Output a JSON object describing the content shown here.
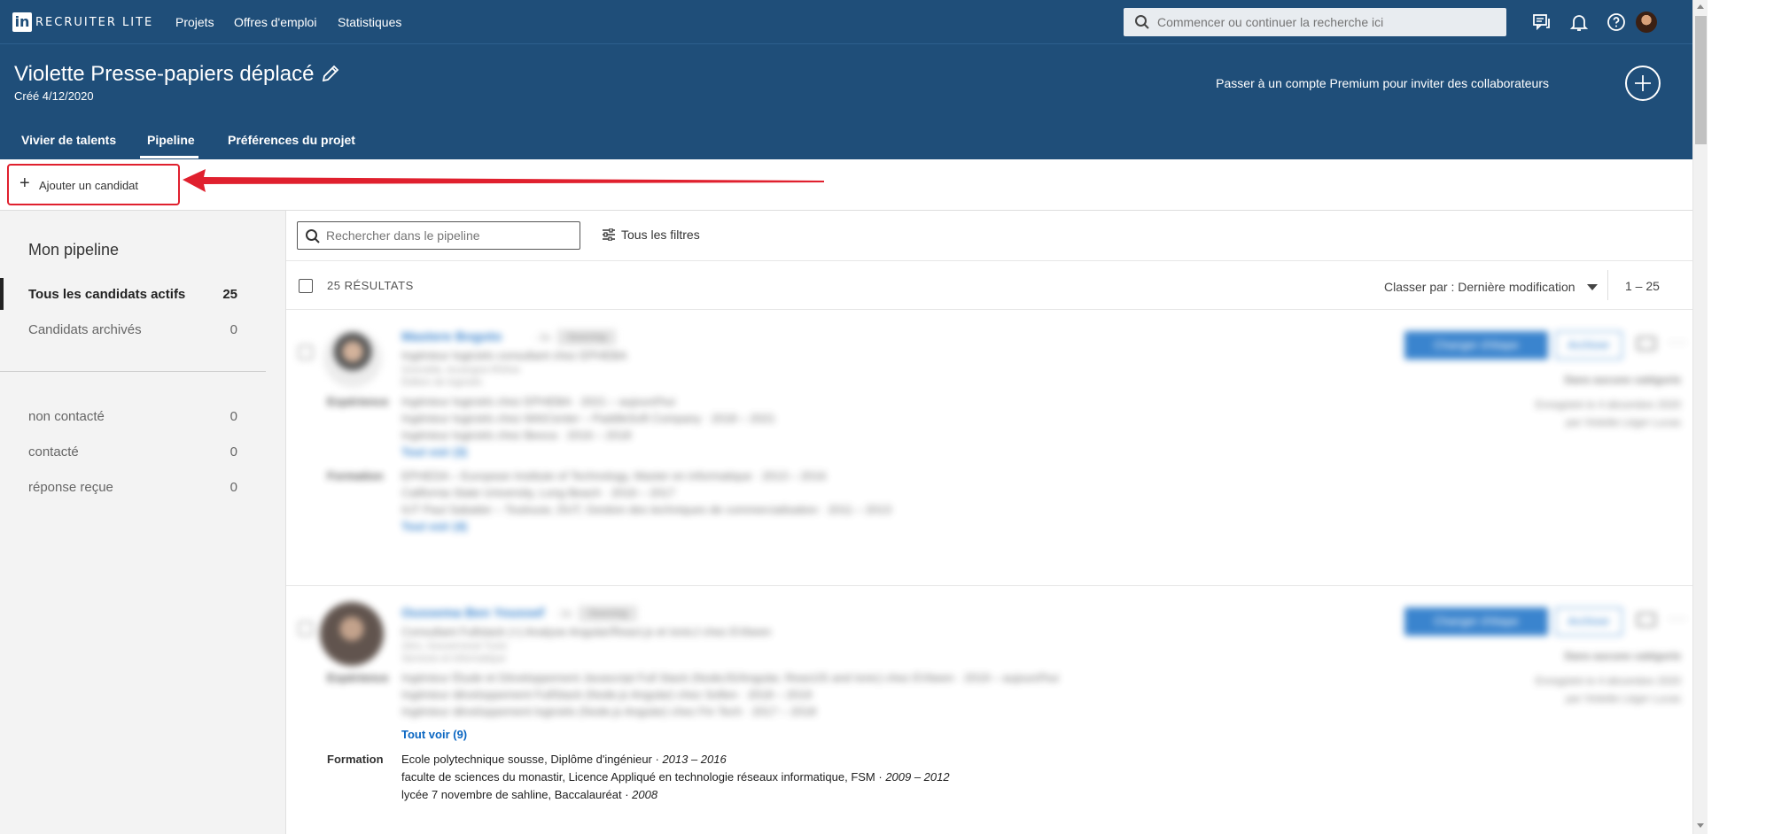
{
  "app": {
    "logo_mark": "in",
    "logo_text": "RECRUITER LITE"
  },
  "nav": {
    "projects": "Projets",
    "jobs": "Offres d'emploi",
    "stats": "Statistiques"
  },
  "search": {
    "placeholder": "Commencer ou continuer la recherche ici"
  },
  "project": {
    "title": "Violette Presse-papiers déplacé",
    "created": "Créé 4/12/2020",
    "premium_text": "Passer à un compte Premium pour inviter des collaborateurs"
  },
  "tabs": [
    {
      "label": "Vivier de talents"
    },
    {
      "label": "Pipeline",
      "active": true
    },
    {
      "label": "Préférences du projet"
    }
  ],
  "toolbar": {
    "add_candidate": "Ajouter un candidat",
    "plus": "+"
  },
  "annotation": {
    "arrow_color": "#e0202e",
    "highlight_color": "#e0202e"
  },
  "sidebar": {
    "title": "Mon pipeline",
    "items": [
      {
        "label": "Tous les candidats actifs",
        "count": "25",
        "active": true
      },
      {
        "label": "Candidats archivés",
        "count": "0"
      },
      {
        "label": "non contacté",
        "count": "0"
      },
      {
        "label": "contacté",
        "count": "0"
      },
      {
        "label": "réponse reçue",
        "count": "0"
      }
    ]
  },
  "pipeline": {
    "search_placeholder": "Rechercher dans le pipeline",
    "filters_label": "Tous les filtres",
    "results": "25 RÉSULTATS",
    "sort_label": "Classer par : Dernière modification",
    "range": "1 – 25"
  },
  "candidates": [
    {
      "name": "Mastere Bogoto",
      "degree": "· 2e",
      "tag": "Sourcing",
      "headline": "Ingénieur logiciels consultant chez EPHEBA",
      "location": "Grenoble, Auvergne-Rhône",
      "industry": "Édition de logiciels",
      "experience_label": "Expérience",
      "experience": [
        "Ingénieur logiciels chez EPHEBA · 2021 – aujourd'hui",
        "Ingénieur logiciels chez MAICenter – PaddleSoft Company · 2018 – 2021",
        "Ingénieur logiciels chez Beoca · 2016 – 2018"
      ],
      "see_all_exp": "Tout voir (3)",
      "education_label": "Formation",
      "education": [
        "EPHEDA – European Institute of Technology, Master en informatique · 2013 – 2016",
        "California State University, Long Beach · 2016 – 2017",
        "IUT Paul Sabatier – Toulouse, DUT, Gestion des techniques de commercialisation · 2011 – 2013"
      ],
      "see_all_edu": "Tout voir (4)",
      "stage_button": "Changer d'étape",
      "archive_button": "Archiver",
      "category": "Dans aucune catégorie",
      "saved": "Enregistré le 4 décembre 2020",
      "saved_by": "par Violette Léger Lucas"
    },
    {
      "name": "Oussema Ben Youssef",
      "degree": "· 2e",
      "tag": "Sourcing",
      "headline": "Consultant Fullstack (+) Analyse Angular/React.js et IonicJ chez EVbeen",
      "location": "Zéro, Gouvernorat Tunis",
      "industry": "Services et informatique",
      "experience_label": "Expérience",
      "experience": [
        "Ingénieur Étude et Développement Javascript Full Stack (NodeJS/Angular, ReactJS and Ionic) chez EVbeen · 2019 – aujourd'hui",
        "Ingénieur développement FullStack (Node.js Angular) chez Sofien · 2018 – 2019",
        "Ingénieur développement logiciels (Node.js Angular) chez Fin Tech · 2017 – 2018"
      ],
      "see_all_exp": "Tout voir (9)",
      "education_label": "Formation",
      "education": [
        {
          "text": "Ecole polytechnique sousse, Diplôme d'ingénieur · ",
          "years": "2013 – 2016"
        },
        {
          "text": "faculte de sciences du monastir, Licence Appliqué en technologie réseaux informatique, FSM · ",
          "years": "2009 – 2012"
        },
        {
          "text": "lycée 7 novembre de sahline, Baccalauréat · ",
          "years": "2008"
        }
      ],
      "stage_button": "Changer d'étape",
      "archive_button": "Archiver",
      "category": "Dans aucune catégorie",
      "saved": "Enregistré le 4 décembre 2020",
      "saved_by": "par Violette Léger Lucas"
    }
  ]
}
